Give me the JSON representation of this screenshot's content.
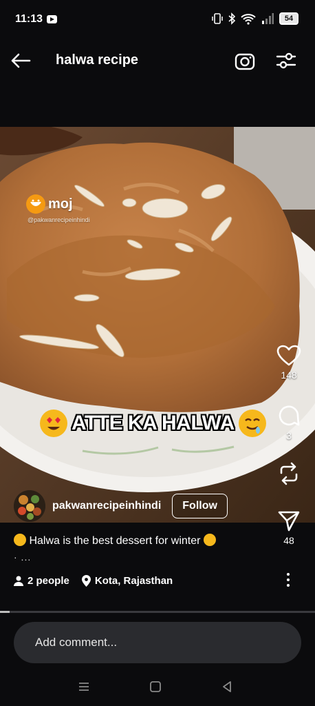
{
  "status_bar": {
    "time": "11:13",
    "battery": "54"
  },
  "header": {
    "title": "halwa recipe"
  },
  "media": {
    "watermark_brand": "moj",
    "watermark_handle": "@pakwanrecipeinhindi",
    "overlay_text": "ATTE KA HALWA"
  },
  "actions": {
    "likes": "148",
    "comments": "3",
    "shares": "48"
  },
  "author": {
    "name": "pakwanrecipeinhindi",
    "follow_label": "Follow"
  },
  "post": {
    "caption": "Halwa is the best dessert for winter",
    "caption_more": "· ...",
    "tagged_people": "2 people",
    "location": "Kota, Rajasthan"
  },
  "playback": {
    "progress": 0.03
  },
  "comment": {
    "placeholder": "Add comment..."
  },
  "icons": [
    "back-arrow-icon",
    "camera-icon",
    "filter-icon",
    "heart-icon",
    "comment-icon",
    "repost-icon",
    "send-icon",
    "person-icon",
    "location-pin-icon",
    "more-vert-icon"
  ]
}
